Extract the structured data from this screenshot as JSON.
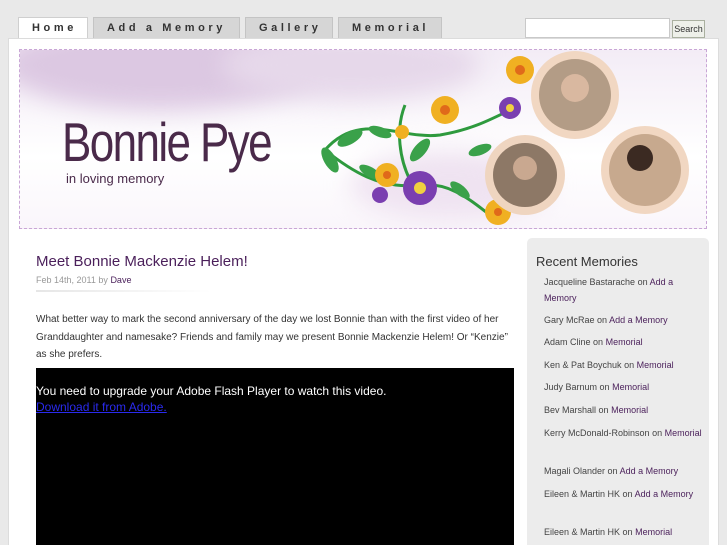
{
  "nav": {
    "tabs": [
      {
        "label": "Home"
      },
      {
        "label": "Add a Memory"
      },
      {
        "label": "Gallery"
      },
      {
        "label": "Memorial"
      }
    ]
  },
  "search": {
    "button_label": "Search",
    "value": ""
  },
  "header": {
    "title": "Bonnie Pye",
    "subtitle": "in loving memory"
  },
  "post": {
    "title": "Meet Bonnie Mackenzie Helem!",
    "date": "Feb 14th, 2011",
    "by": "by",
    "author": "Dave",
    "body": "What better way to mark the second anniversary of the day we lost Bonnie than with the first video of her Granddaughter and namesake? Friends and family may we present Bonnie Mackenzie Helem! Or “Kenzie” as she prefers.",
    "video_message": "You need to upgrade your Adobe Flash Player to watch this video.",
    "video_link": "Download it from Adobe."
  },
  "sidebar": {
    "title": "Recent Memories",
    "on": "on",
    "items": [
      {
        "name": "Jacqueline Bastarache",
        "link": "Add a Memory"
      },
      {
        "name": "Gary McRae",
        "link": "Add a Memory"
      },
      {
        "name": "Adam Cline",
        "link": "Memorial"
      },
      {
        "name": "Ken & Pat Boychuk",
        "link": "Memorial"
      },
      {
        "name": "Judy Barnum",
        "link": "Memorial"
      },
      {
        "name": "Bev Marshall",
        "link": "Memorial"
      },
      {
        "name": "Kerry McDonald-Robinson",
        "link": "Memorial"
      },
      {
        "name": "Magali Olander",
        "link": "Add a Memory"
      },
      {
        "name": "Eileen & Martin HK",
        "link": "Add a Memory"
      },
      {
        "name": "Eileen & Martin HK",
        "link": "Memorial"
      }
    ]
  },
  "colors": {
    "accent": "#4a1f5a",
    "header_border": "#c9a6d6"
  },
  "icons": [
    "flower-icon",
    "photo-frame-icon"
  ]
}
